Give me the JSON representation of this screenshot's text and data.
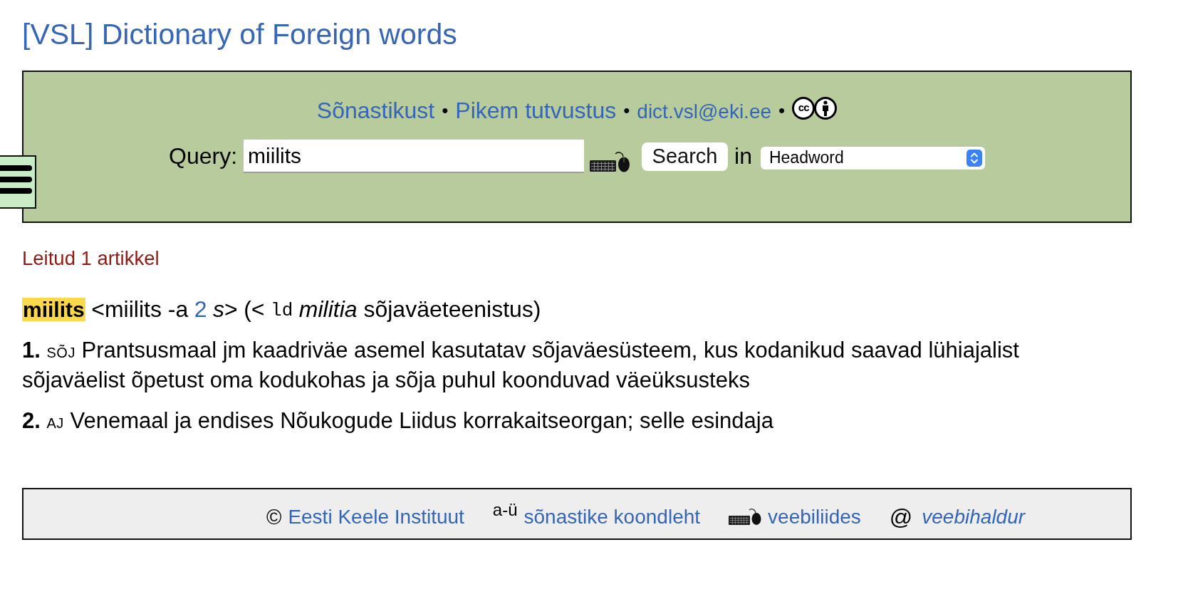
{
  "title": "[VSL] Dictionary of Foreign words",
  "search_panel": {
    "links": [
      {
        "kind": "link",
        "text": "Sõnastikust"
      },
      {
        "kind": "separator",
        "text": "•"
      },
      {
        "kind": "link",
        "text": "Pikem tutvustus"
      },
      {
        "kind": "separator",
        "text": "•"
      },
      {
        "kind": "email",
        "text": "dict.vsl@eki.ee"
      },
      {
        "kind": "separator",
        "text": "•"
      },
      {
        "kind": "license",
        "text": "cc"
      }
    ],
    "query_label": "Query:",
    "query": {
      "value": "miilits"
    },
    "search_button": "Search",
    "in_label": "in",
    "field_select": {
      "value": "Headword"
    }
  },
  "result_count": "Leitud 1 artikkel",
  "entry": {
    "headword": "miilits",
    "highlighted": true,
    "segments": [
      {
        "kind": "text",
        "text": "<miilits -a"
      },
      {
        "kind": "link",
        "text": "2"
      },
      {
        "kind": "text",
        "text": "*s*>"
      },
      {
        "kind": "text",
        "text": "(<"
      },
      {
        "kind": "code",
        "text": "ld"
      },
      {
        "kind": "text",
        "text": "*militia* sõjaväeteenistus)"
      }
    ]
  },
  "senses": [
    {
      "number": "1.",
      "domain": "SÕJ",
      "text": "Prantsusmaal jm kaadriväe asemel kasutatav sõjaväesüsteem, kus kodanikud saavad lühiajalist sõjaväelist õpetust oma kodukohas ja sõja puhul koonduvad väeüksusteks"
    },
    {
      "number": "2.",
      "domain": "AJ",
      "text": "Venemaal ja endises Nõukogude Liidus korrakaitseorgan; selle esindaja"
    }
  ],
  "footer": {
    "items": [
      {
        "kind": "copyright",
        "symbol": "©",
        "link": "Eesti Keele Instituut",
        "italic": false
      },
      {
        "kind": "index",
        "symbol": "a-ü",
        "link": "sõnastike koondleht",
        "italic": false
      },
      {
        "kind": "keyboard",
        "link": "veebiliides",
        "italic": false
      },
      {
        "kind": "at",
        "symbol": "@",
        "link": "veebihaldur",
        "italic": true
      }
    ]
  }
}
